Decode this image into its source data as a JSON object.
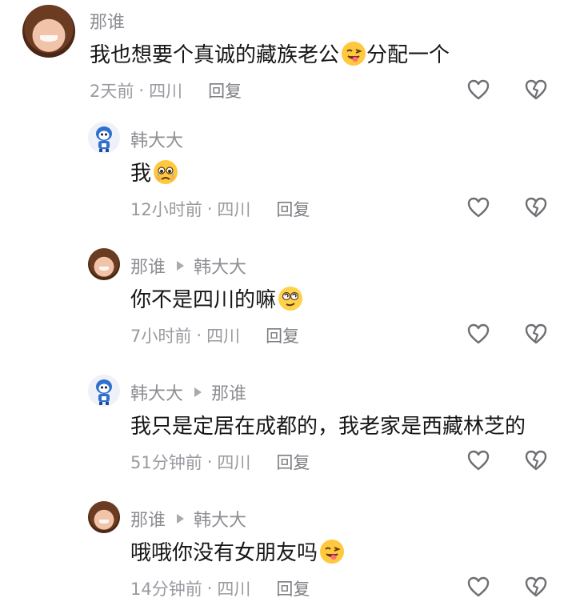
{
  "comments": [
    {
      "user": "那谁",
      "reply_to": "",
      "text": "我也想要个真诚的藏族老公",
      "text_after": "分配一个",
      "emoji": "wink-tongue-emoji",
      "time": "2天前",
      "location": "四川",
      "reply_label": "回复",
      "avatar": "girl-avatar"
    },
    {
      "user": "韩大大",
      "reply_to": "",
      "text": "我",
      "text_after": "",
      "emoji": "crying-pleading-emoji",
      "time": "12小时前",
      "location": "四川",
      "reply_label": "回复",
      "avatar": "robot-avatar"
    },
    {
      "user": "那谁",
      "reply_to": "韩大大",
      "text": "你不是四川的嘛",
      "text_after": "",
      "emoji": "dizzy-rolling-eyes-emoji",
      "time": "7小时前",
      "location": "四川",
      "reply_label": "回复",
      "avatar": "girl-avatar"
    },
    {
      "user": "韩大大",
      "reply_to": "那谁",
      "text": "我只是定居在成都的，我老家是西藏林芝的",
      "text_after": "",
      "emoji": "",
      "time": "51分钟前",
      "location": "四川",
      "reply_label": "回复",
      "avatar": "robot-avatar"
    },
    {
      "user": "那谁",
      "reply_to": "韩大大",
      "text": "哦哦你没有女朋友吗",
      "text_after": "",
      "emoji": "wink-tongue-emoji",
      "time": "14分钟前",
      "location": "四川",
      "reply_label": "回复",
      "avatar": "girl-avatar"
    }
  ],
  "meta_separator": "·",
  "icons": {
    "like": "heart-outline-icon",
    "dislike": "broken-heart-icon"
  },
  "colors": {
    "username": "#8e8e93",
    "meta": "#9a9aa0",
    "text": "#161616"
  }
}
